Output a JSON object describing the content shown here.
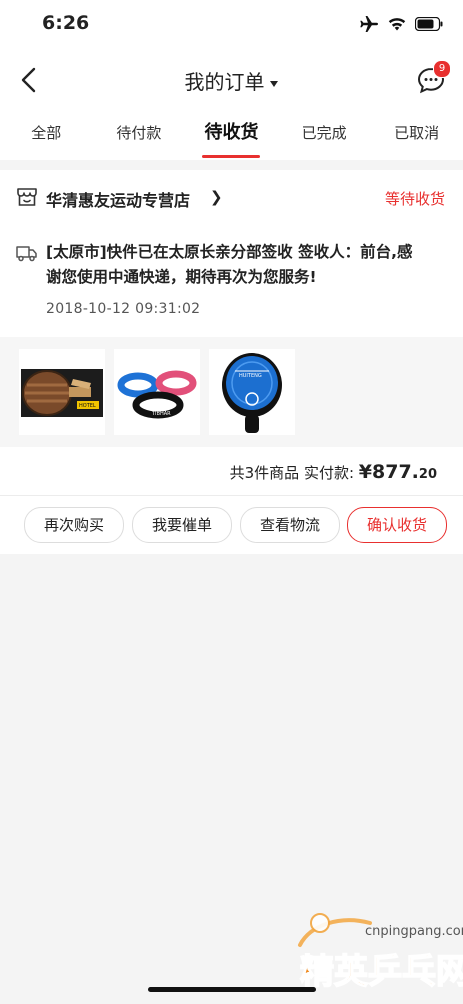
{
  "status_bar": {
    "time": "6:26"
  },
  "nav": {
    "title": "我的订单",
    "message_badge": "9"
  },
  "tabs": [
    {
      "label": "全部"
    },
    {
      "label": "待付款"
    },
    {
      "label": "待收货",
      "active": true
    },
    {
      "label": "已完成"
    },
    {
      "label": "已取消"
    }
  ],
  "order": {
    "store_name": "华清惠友运动专营店",
    "status": "等待收货",
    "logistics_text": "[太原市]快件已在太原长亲分部签收 签收人：前台,感谢您使用中通快递，期待再次为您服务!",
    "logistics_time": "2018-10-12 09:31:02",
    "goods": [
      {
        "name": "table-tennis-blade"
      },
      {
        "name": "edge-protection-tapes"
      },
      {
        "name": "racket-case"
      }
    ],
    "summary_prefix": "共3件商品  实付款:",
    "amount_main": "¥877.",
    "amount_cents": "20",
    "actions": {
      "buy_again": "再次购买",
      "urge": "我要催单",
      "track": "查看物流",
      "confirm": "确认收货"
    }
  },
  "watermark": {
    "site": "cnpingpang.com",
    "brand": "精英乒乓网"
  },
  "colors": {
    "accent": "#e8302f",
    "background": "#f4f4f4"
  }
}
